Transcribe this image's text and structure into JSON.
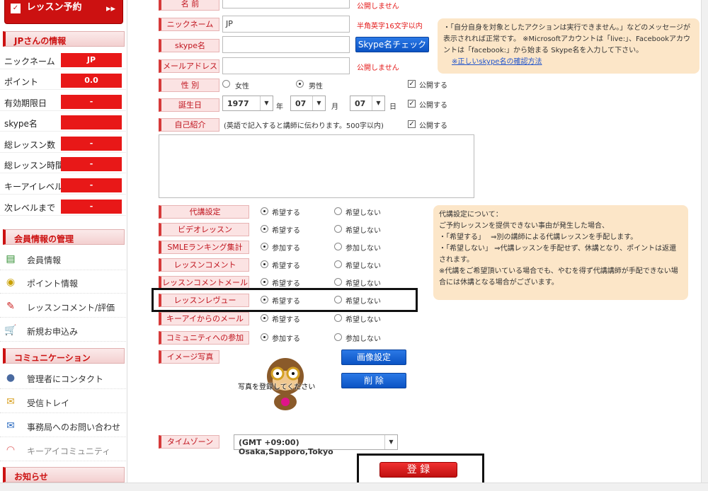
{
  "sidebar": {
    "reserve_button": "レッスン予約",
    "user_info_title": "JPさんの情報",
    "info_rows": [
      {
        "label": "ニックネーム",
        "value": "JP"
      },
      {
        "label": "ポイント",
        "value": "0.0"
      },
      {
        "label": "有効期限日",
        "value": "-"
      },
      {
        "label": "skype名",
        "value": ""
      },
      {
        "label": "総レッスン数",
        "value": "-"
      },
      {
        "label": "総レッスン時間",
        "value": "-"
      },
      {
        "label": "キーアイレベル",
        "value": "-"
      },
      {
        "label": "次レベルまで",
        "value": "-"
      }
    ],
    "member_title": "会員情報の管理",
    "member_items": [
      "会員情報",
      "ポイント情報",
      "レッスンコメント/評価",
      "新規お申込み"
    ],
    "comm_title": "コミュニケーション",
    "comm_items": [
      "管理者にコンタクト",
      "受信トレイ",
      "事務局へのお問い合わせ",
      "キーアイコミュニティ"
    ],
    "news_title": "お知らせ"
  },
  "form": {
    "name_label": "名 前",
    "name_note": "公開しません",
    "nick_label": "ニックネーム",
    "nick_value": "JP",
    "nick_note": "半角英字16文字以内",
    "skype_label": "skype名",
    "skype_check_btn": "Skype名チェック",
    "mail_label": "メールアドレス",
    "mail_note": "公開しません",
    "gender_label": "性 別",
    "gender_female": "女性",
    "gender_male": "男性",
    "public_label": "公開する",
    "birth_label": "誕生日",
    "birth_year": "1977",
    "birth_year_unit": "年",
    "birth_month": "07",
    "birth_month_unit": "月",
    "birth_day": "07",
    "birth_day_unit": "日",
    "intro_label": "自己紹介",
    "intro_note": "(英語で記入すると講師に伝わります。500字以内)",
    "skype_info": {
      "line1": "・「自分自身を対象としたアクションは実行できません。」などのメッセージが表示されれば正常です。 ※Microsoftアカウントは「live:」、Facebookアカウントは「facebook:」から始まる Skype名を入力して下さい。",
      "link": "※正しいskype名の確認方法"
    },
    "prefs": [
      {
        "label": "代講設定",
        "opt1": "希望する",
        "opt2": "希望しない"
      },
      {
        "label": "ビデオレッスン",
        "opt1": "希望する",
        "opt2": "希望しない"
      },
      {
        "label": "SMLEランキング集計",
        "opt1": "参加する",
        "opt2": "参加しない"
      },
      {
        "label": "レッスンコメント",
        "opt1": "希望する",
        "opt2": "希望しない"
      },
      {
        "label": "レッスンコメントメール",
        "opt1": "希望する",
        "opt2": "希望しない"
      },
      {
        "label": "レッスンレヴュー",
        "opt1": "希望する",
        "opt2": "希望しない"
      },
      {
        "label": "キーアイからのメール",
        "opt1": "希望する",
        "opt2": "希望しない"
      },
      {
        "label": "コミュニティへの参加",
        "opt1": "参加する",
        "opt2": "参加しない"
      }
    ],
    "sub_info": {
      "title": "代講設定について：",
      "line1": "ご予約レッスンを提供できない事由が発生した場合、",
      "line2": "・「希望する」　 ⇒別の講師による代講レッスンを手配します。",
      "line3": "・「希望しない」 ⇒代講レッスンを手配せず、休講となり、ポイントは返還されます。",
      "line4": "※代講をご希望頂いている場合でも、やむを得ず代講講師が手配できない場合には休講となる場合がございます。"
    },
    "photo_label": "イメージ写真",
    "photo_placeholder": "写真を登録してください",
    "image_set_btn": "画像設定",
    "delete_btn": "削 除",
    "tz_label": "タイムゾーン",
    "tz_value": "(GMT +09:00) Osaka,Sapporo,Tokyo",
    "submit_btn": "登 録"
  }
}
